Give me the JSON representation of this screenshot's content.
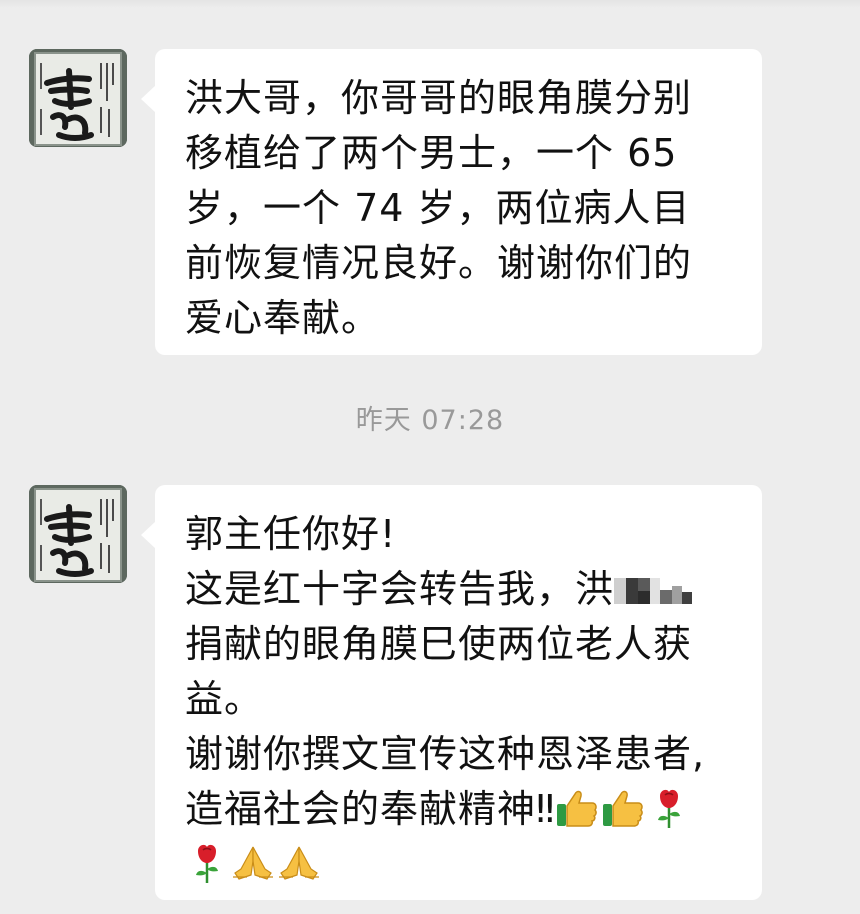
{
  "messages": [
    {
      "sender_avatar": "calligraphy-scroll-avatar",
      "lines": [
        "洪大哥，你哥哥的眼角膜分别",
        "移植给了两个男士，一个 65",
        "岁，一个 74 岁，两位病人目",
        "前恢复情况良好。谢谢你们的",
        "爱心奉献。"
      ]
    },
    {
      "sender_avatar": "calligraphy-scroll-avatar",
      "lines": [
        "郭主任你好!",
        "这是红十字会转告我，洪",
        "捐献的眼角膜巳使两位老人获",
        "益。",
        "谢谢你撰文宣传这种恩泽患者,",
        "造福社会的奉献精神‼"
      ],
      "emojis_line6": [
        "thumbs-up-icon",
        "thumbs-up-icon",
        "rose-icon"
      ],
      "emojis_line7": [
        "rose-icon",
        "praying-hands-icon",
        "praying-hands-icon"
      ]
    }
  ],
  "timestamp": "昨天 07:28",
  "colors": {
    "background": "#ededed",
    "bubble": "#ffffff",
    "text": "#111111",
    "timestamp": "#999999"
  }
}
